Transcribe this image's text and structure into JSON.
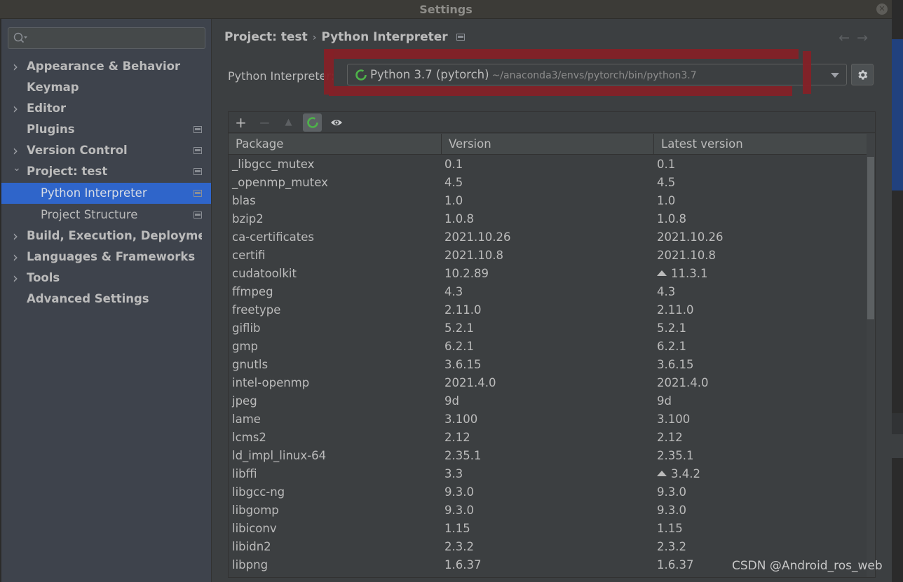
{
  "window": {
    "title": "Settings",
    "close_icon": "close-icon"
  },
  "sidebar": {
    "search": {
      "value": "",
      "placeholder": ""
    },
    "items": [
      {
        "label": "Appearance & Behavior",
        "chevron": "right",
        "project_icon": false
      },
      {
        "label": "Keymap",
        "chevron": "none",
        "project_icon": false
      },
      {
        "label": "Editor",
        "chevron": "right",
        "project_icon": false
      },
      {
        "label": "Plugins",
        "chevron": "none",
        "project_icon": true
      },
      {
        "label": "Version Control",
        "chevron": "right",
        "project_icon": true
      },
      {
        "label": "Project: test",
        "chevron": "down",
        "project_icon": true
      },
      {
        "label": "Python Interpreter",
        "chevron": "none",
        "project_icon": true,
        "child": true,
        "selected": true
      },
      {
        "label": "Project Structure",
        "chevron": "none",
        "project_icon": true,
        "child": true
      },
      {
        "label": "Build, Execution, Deployment",
        "chevron": "right",
        "project_icon": false
      },
      {
        "label": "Languages & Frameworks",
        "chevron": "right",
        "project_icon": false
      },
      {
        "label": "Tools",
        "chevron": "right",
        "project_icon": false
      },
      {
        "label": "Advanced Settings",
        "chevron": "none",
        "project_icon": false
      }
    ]
  },
  "header": {
    "breadcrumb": [
      "Project: test",
      "Python Interpreter"
    ],
    "breadcrumb_sep": "›",
    "back_label": "←",
    "forward_label": "→"
  },
  "interpreter": {
    "label": "Python Interpreter:",
    "name": "Python 3.7 (pytorch)",
    "path": "~/anaconda3/envs/pytorch/bin/python3.7"
  },
  "toolbar": {
    "add_label": "+",
    "remove_label": "−",
    "upgrade_label": "▲"
  },
  "table": {
    "headers": [
      "Package",
      "Version",
      "Latest version"
    ],
    "rows": [
      {
        "package": "_libgcc_mutex",
        "version": "0.1",
        "latest": "0.1",
        "upgrade": false
      },
      {
        "package": "_openmp_mutex",
        "version": "4.5",
        "latest": "4.5",
        "upgrade": false
      },
      {
        "package": "blas",
        "version": "1.0",
        "latest": "1.0",
        "upgrade": false
      },
      {
        "package": "bzip2",
        "version": "1.0.8",
        "latest": "1.0.8",
        "upgrade": false
      },
      {
        "package": "ca-certificates",
        "version": "2021.10.26",
        "latest": "2021.10.26",
        "upgrade": false
      },
      {
        "package": "certifi",
        "version": "2021.10.8",
        "latest": "2021.10.8",
        "upgrade": false
      },
      {
        "package": "cudatoolkit",
        "version": "10.2.89",
        "latest": "11.3.1",
        "upgrade": true
      },
      {
        "package": "ffmpeg",
        "version": "4.3",
        "latest": "4.3",
        "upgrade": false
      },
      {
        "package": "freetype",
        "version": "2.11.0",
        "latest": "2.11.0",
        "upgrade": false
      },
      {
        "package": "giflib",
        "version": "5.2.1",
        "latest": "5.2.1",
        "upgrade": false
      },
      {
        "package": "gmp",
        "version": "6.2.1",
        "latest": "6.2.1",
        "upgrade": false
      },
      {
        "package": "gnutls",
        "version": "3.6.15",
        "latest": "3.6.15",
        "upgrade": false
      },
      {
        "package": "intel-openmp",
        "version": "2021.4.0",
        "latest": "2021.4.0",
        "upgrade": false
      },
      {
        "package": "jpeg",
        "version": "9d",
        "latest": "9d",
        "upgrade": false
      },
      {
        "package": "lame",
        "version": "3.100",
        "latest": "3.100",
        "upgrade": false
      },
      {
        "package": "lcms2",
        "version": "2.12",
        "latest": "2.12",
        "upgrade": false
      },
      {
        "package": "ld_impl_linux-64",
        "version": "2.35.1",
        "latest": "2.35.1",
        "upgrade": false
      },
      {
        "package": "libffi",
        "version": "3.3",
        "latest": "3.4.2",
        "upgrade": true
      },
      {
        "package": "libgcc-ng",
        "version": "9.3.0",
        "latest": "9.3.0",
        "upgrade": false
      },
      {
        "package": "libgomp",
        "version": "9.3.0",
        "latest": "9.3.0",
        "upgrade": false
      },
      {
        "package": "libiconv",
        "version": "1.15",
        "latest": "1.15",
        "upgrade": false
      },
      {
        "package": "libidn2",
        "version": "2.3.2",
        "latest": "2.3.2",
        "upgrade": false
      },
      {
        "package": "libpng",
        "version": "1.6.37",
        "latest": "1.6.37",
        "upgrade": false
      }
    ]
  },
  "colors": {
    "selection": "#2f65ca",
    "annotation_red": "#8b1c22",
    "spinner_green": "#4eb34a"
  },
  "watermark": "CSDN @Android_ros_web"
}
